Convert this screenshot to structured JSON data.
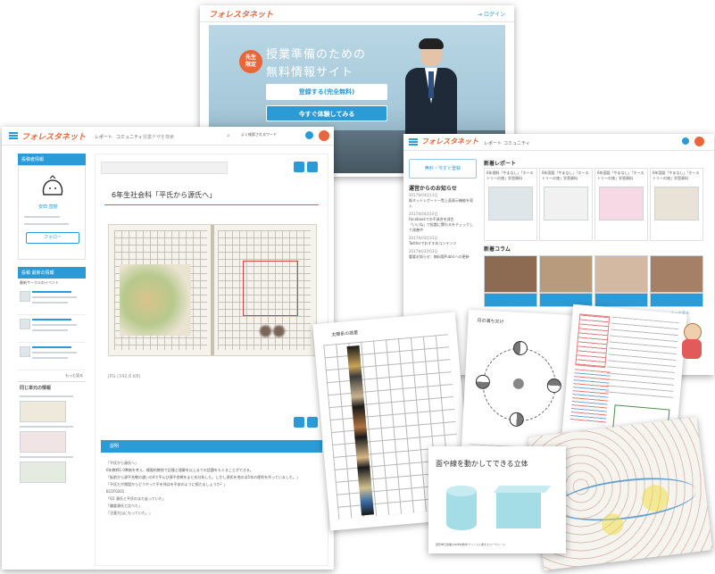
{
  "hero": {
    "logo": "フォレスタネット",
    "login": "ログイン",
    "badge": "先生\n限定",
    "headline_1": "授業準備のための",
    "headline_2": "無料情報サイト",
    "register_button": "登録する(完全無料)",
    "try_button": "今すぐ体験してみる"
  },
  "report_page": {
    "logo": "フォレスタネット",
    "nav": [
      "レポート",
      "コミュニティ"
    ],
    "search_placeholder": "授業デザを検索",
    "user_label": "よく検索されるワード",
    "profile_header": "投稿者情報",
    "name": "安田 直樹",
    "follow_button": "フォロー",
    "title": "6年生社会科「平氏から源氏へ」",
    "caption": "JPG (342.8 KB)",
    "description_header": "説明",
    "sidebar_header": "投稿 最新の情報",
    "sidebar_events": "最新サークルのイベント",
    "related_header": "同じ単元の情報",
    "sidebar_more": "もっと見る",
    "body_lines": [
      "「平氏から源氏へ」",
      "6年教師1.0準拠を考え、模擬的教授で記憶と理解を以上までの話題をもぐることができる。",
      "「板前から源平合戦の違いの4で平んび源平合戦をまとめ分析した。しかし源氏を他のは5年の便利を作っていました。」",
      "「平氏だが帰国からどうやって平を残はを平安のように続たましょうか？」",
      "B11F0201",
      "「Q1 源氏と平氏のまだ走っていた」",
      "「鎌倉源氏と比べた」",
      "「注意大山にもっていた。」"
    ]
  },
  "home_page": {
    "logo": "フォレスタネット",
    "nav": [
      "レポート",
      "コミュニティ"
    ],
    "new_reports": "新着レポート",
    "notices": "運営からのお知らせ",
    "new_columns": "新着コラム",
    "register_cta": "無料・今すぐ登録",
    "more": "もっと見る",
    "report_cards": [
      "6年理科「やまなし」「オーストリーの旅」学習資料",
      "6年国語「やまなし」「オーストリーの旅」学習資料",
      "6年国語「やまなし」「オーストリーの旅」学習資料",
      "6年国語「やまなし」「オーストリーの旅」学習資料"
    ],
    "notice_items": [
      "2017年04月11日",
      "既ネットレポート一覧上面表示機能を導入",
      "2017年04月10日",
      "Facebookでの不具合を発生",
      "「いいね」で拡散に関わるをチェックして改善中",
      "2017年03月31日",
      "Twitterでおすすめコンテンツ",
      "2017年03月03日",
      "重要お知らせ：無料版Publicへの更新"
    ]
  },
  "worksheets": {
    "planets_title": "太陽系の惑星",
    "moon_title": "月の満ち欠け",
    "solid_title": "面や線を動かしてできる立体",
    "solid_caption": "図形単元授業の中学校数学プリントに関するワークシート"
  }
}
